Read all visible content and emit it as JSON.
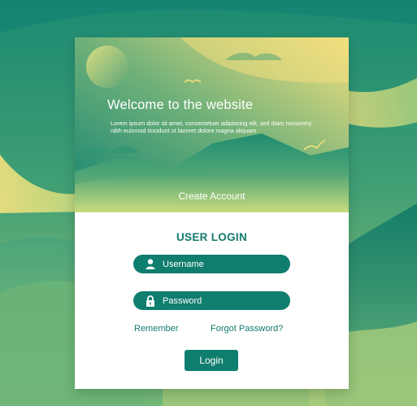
{
  "hero": {
    "title": "Welcome to the website",
    "body": "Lorem ipsum dolor sit amet, consectetuer adipiscing elit, sed diam nonummy nibh euismod tincidunt ut laoreet dolore magna aliquam",
    "create_account_label": "Create Account"
  },
  "login": {
    "title": "USER LOGIN",
    "username_placeholder": "Username",
    "password_placeholder": "Password",
    "remember_label": "Remember",
    "forgot_label": "Forgot Password?",
    "login_button_label": "Login"
  },
  "icons": {
    "username": "user-icon",
    "password": "lock-icon"
  },
  "colors": {
    "accent": "#0f7e6e",
    "title_text": "#127a6b",
    "hero_yellow": "#f3e07f",
    "hero_teal": "#138372"
  }
}
